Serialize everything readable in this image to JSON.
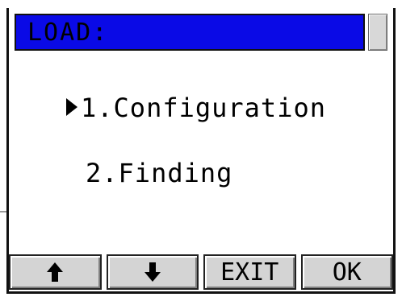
{
  "title": "LOAD:",
  "menu": {
    "items": [
      {
        "label": "1.Configuration",
        "selected": true
      },
      {
        "label": "2.Finding",
        "selected": false
      }
    ]
  },
  "softkeys": {
    "up": {
      "icon": "arrow-up-icon"
    },
    "down": {
      "icon": "arrow-down-icon"
    },
    "exit_label": "EXIT",
    "ok_label": "OK"
  },
  "colors": {
    "title_bar": "#0a0ae6",
    "button_face": "#d4d4d4"
  }
}
